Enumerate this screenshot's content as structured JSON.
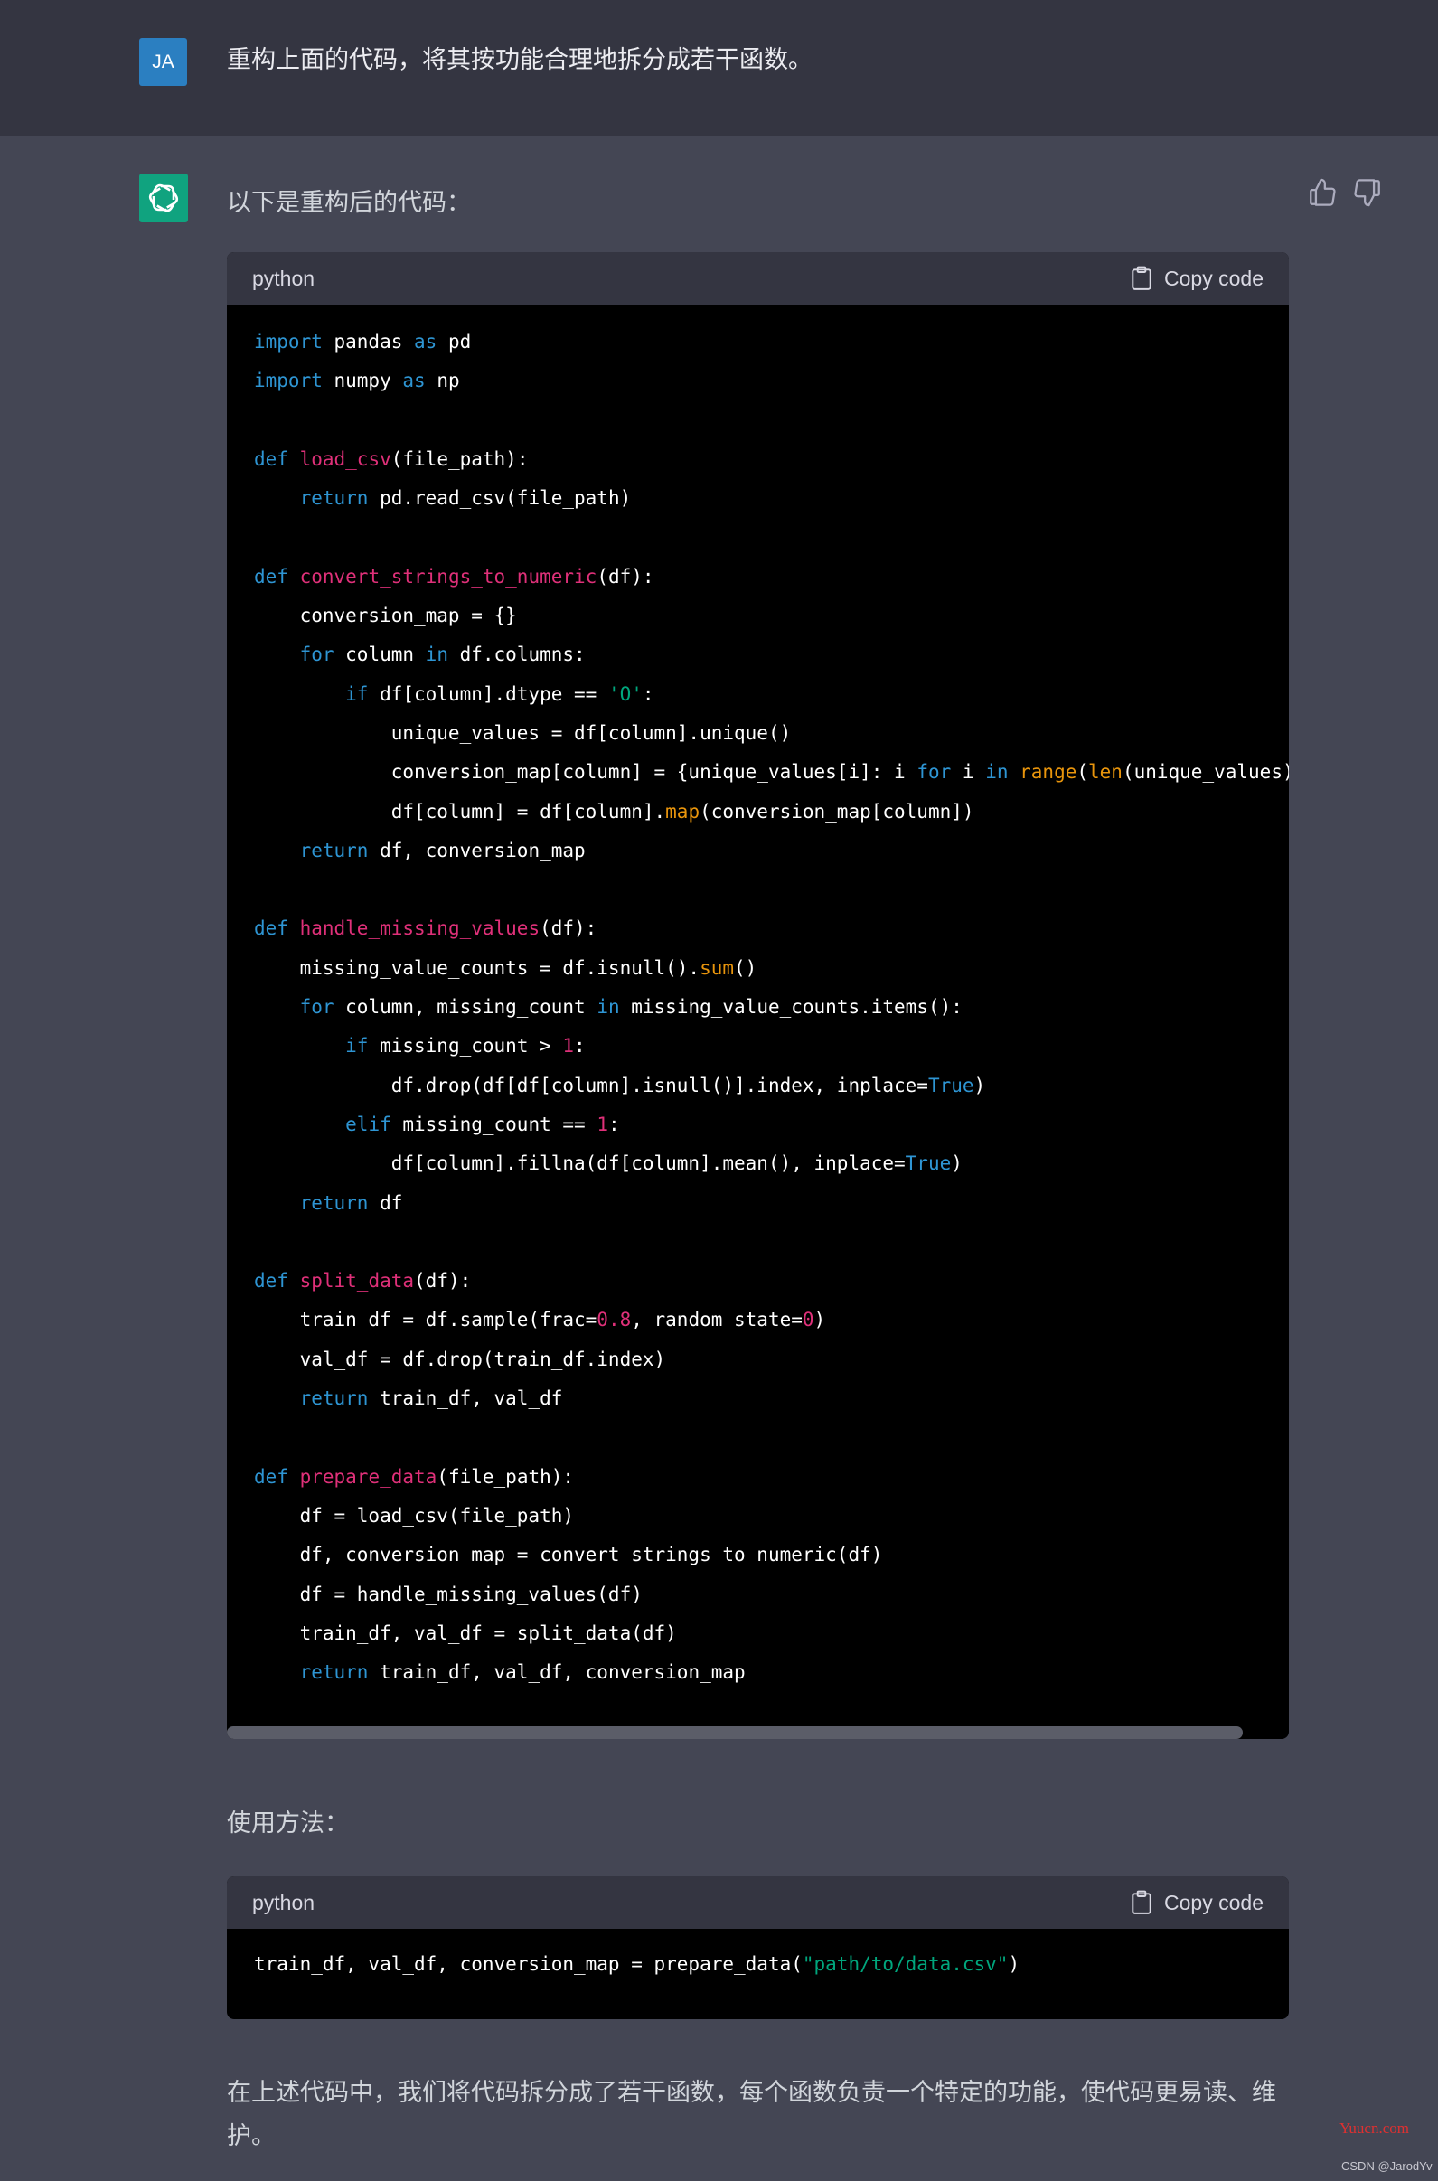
{
  "user": {
    "avatar_initials": "JA",
    "message": "重构上面的代码，将其按功能合理地拆分成若干函数。"
  },
  "assistant": {
    "avatar_icon": "openai-logo-icon",
    "intro": "以下是重构后的代码：",
    "usage_heading": "使用方法：",
    "summary": "在上述代码中，我们将代码拆分成了若干函数，每个函数负责一个特定的功能，使代码更易读、维护。",
    "feedback": {
      "thumbs_up_icon": "thumbs-up-icon",
      "thumbs_down_icon": "thumbs-down-icon"
    }
  },
  "syntax_colors": {
    "kw": "#2e95d3",
    "fn": "#df3079",
    "bi": "#e9950c",
    "str": "#00a67d",
    "num": "#df3079",
    "tx": "#ffffff"
  },
  "code_blocks": [
    {
      "language": "python",
      "copy_label": "Copy code",
      "scrollbar_position": 0.0,
      "lines": [
        [
          [
            "kw",
            "import"
          ],
          [
            "tx",
            " pandas "
          ],
          [
            "kw",
            "as"
          ],
          [
            "tx",
            " pd"
          ]
        ],
        [
          [
            "kw",
            "import"
          ],
          [
            "tx",
            " numpy "
          ],
          [
            "kw",
            "as"
          ],
          [
            "tx",
            " np"
          ]
        ],
        [],
        [
          [
            "kw",
            "def"
          ],
          [
            "tx",
            " "
          ],
          [
            "fn",
            "load_csv"
          ],
          [
            "tx",
            "(file_path):"
          ]
        ],
        [
          [
            "tx",
            "    "
          ],
          [
            "kw",
            "return"
          ],
          [
            "tx",
            " pd.read_csv(file_path)"
          ]
        ],
        [],
        [
          [
            "kw",
            "def"
          ],
          [
            "tx",
            " "
          ],
          [
            "fn",
            "convert_strings_to_numeric"
          ],
          [
            "tx",
            "(df):"
          ]
        ],
        [
          [
            "tx",
            "    conversion_map = {}"
          ]
        ],
        [
          [
            "tx",
            "    "
          ],
          [
            "kw",
            "for"
          ],
          [
            "tx",
            " column "
          ],
          [
            "kw",
            "in"
          ],
          [
            "tx",
            " df.columns:"
          ]
        ],
        [
          [
            "tx",
            "        "
          ],
          [
            "kw",
            "if"
          ],
          [
            "tx",
            " df[column].dtype == "
          ],
          [
            "str",
            "'O'"
          ],
          [
            "tx",
            ":"
          ]
        ],
        [
          [
            "tx",
            "            unique_values = df[column].unique()"
          ]
        ],
        [
          [
            "tx",
            "            conversion_map[column] = {unique_values[i]: i "
          ],
          [
            "kw",
            "for"
          ],
          [
            "tx",
            " i "
          ],
          [
            "kw",
            "in"
          ],
          [
            "tx",
            " "
          ],
          [
            "bi",
            "range"
          ],
          [
            "tx",
            "("
          ],
          [
            "bi",
            "len"
          ],
          [
            "tx",
            "(unique_values)))}"
          ]
        ],
        [
          [
            "tx",
            "            df[column] = df[column]."
          ],
          [
            "bi",
            "map"
          ],
          [
            "tx",
            "(conversion_map[column])"
          ]
        ],
        [
          [
            "tx",
            "    "
          ],
          [
            "kw",
            "return"
          ],
          [
            "tx",
            " df, conversion_map"
          ]
        ],
        [],
        [
          [
            "kw",
            "def"
          ],
          [
            "tx",
            " "
          ],
          [
            "fn",
            "handle_missing_values"
          ],
          [
            "tx",
            "(df):"
          ]
        ],
        [
          [
            "tx",
            "    missing_value_counts = df.isnull()."
          ],
          [
            "bi",
            "sum"
          ],
          [
            "tx",
            "()"
          ]
        ],
        [
          [
            "tx",
            "    "
          ],
          [
            "kw",
            "for"
          ],
          [
            "tx",
            " column, missing_count "
          ],
          [
            "kw",
            "in"
          ],
          [
            "tx",
            " missing_value_counts.items():"
          ]
        ],
        [
          [
            "tx",
            "        "
          ],
          [
            "kw",
            "if"
          ],
          [
            "tx",
            " missing_count > "
          ],
          [
            "num",
            "1"
          ],
          [
            "tx",
            ":"
          ]
        ],
        [
          [
            "tx",
            "            df.drop(df[df[column].isnull()].index, inplace="
          ],
          [
            "kw",
            "True"
          ],
          [
            "tx",
            ")"
          ]
        ],
        [
          [
            "tx",
            "        "
          ],
          [
            "kw",
            "elif"
          ],
          [
            "tx",
            " missing_count == "
          ],
          [
            "num",
            "1"
          ],
          [
            "tx",
            ":"
          ]
        ],
        [
          [
            "tx",
            "            df[column].fillna(df[column].mean(), inplace="
          ],
          [
            "kw",
            "True"
          ],
          [
            "tx",
            ")"
          ]
        ],
        [
          [
            "tx",
            "    "
          ],
          [
            "kw",
            "return"
          ],
          [
            "tx",
            " df"
          ]
        ],
        [],
        [
          [
            "kw",
            "def"
          ],
          [
            "tx",
            " "
          ],
          [
            "fn",
            "split_data"
          ],
          [
            "tx",
            "(df):"
          ]
        ],
        [
          [
            "tx",
            "    train_df = df.sample(frac="
          ],
          [
            "num",
            "0.8"
          ],
          [
            "tx",
            ", random_state="
          ],
          [
            "num",
            "0"
          ],
          [
            "tx",
            ")"
          ]
        ],
        [
          [
            "tx",
            "    val_df = df.drop(train_df.index)"
          ]
        ],
        [
          [
            "tx",
            "    "
          ],
          [
            "kw",
            "return"
          ],
          [
            "tx",
            " train_df, val_df"
          ]
        ],
        [],
        [
          [
            "kw",
            "def"
          ],
          [
            "tx",
            " "
          ],
          [
            "fn",
            "prepare_data"
          ],
          [
            "tx",
            "(file_path):"
          ]
        ],
        [
          [
            "tx",
            "    df = load_csv(file_path)"
          ]
        ],
        [
          [
            "tx",
            "    df, conversion_map = convert_strings_to_numeric(df)"
          ]
        ],
        [
          [
            "tx",
            "    df = handle_missing_values(df)"
          ]
        ],
        [
          [
            "tx",
            "    train_df, val_df = split_data(df)"
          ]
        ],
        [
          [
            "tx",
            "    "
          ],
          [
            "kw",
            "return"
          ],
          [
            "tx",
            " train_df, val_df, conversion_map"
          ]
        ]
      ]
    },
    {
      "language": "python",
      "copy_label": "Copy code",
      "lines": [
        [
          [
            "tx",
            "train_df, val_df, conversion_map = prepare_data("
          ],
          [
            "str",
            "\"path/to/data.csv\""
          ],
          [
            "tx",
            ")"
          ]
        ]
      ]
    }
  ],
  "watermarks": {
    "site": "Yuucn.com",
    "csdn": "CSDN @JarodYv"
  }
}
